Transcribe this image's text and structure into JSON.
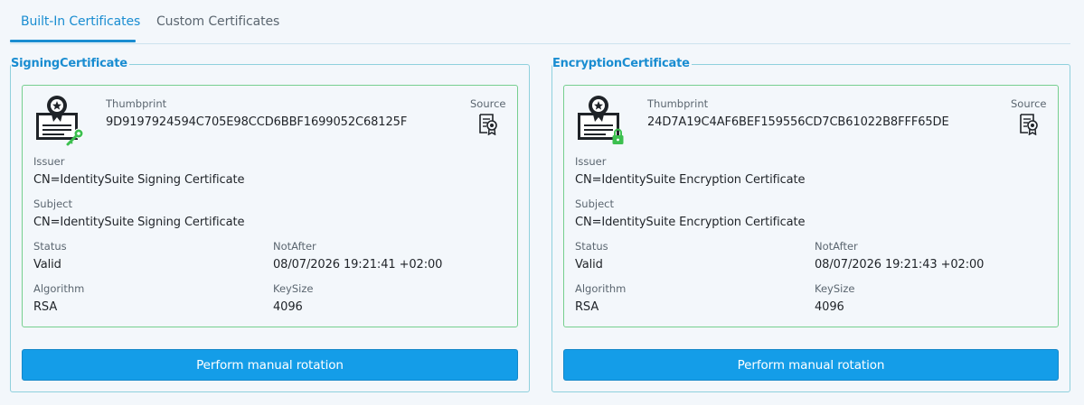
{
  "tabs": [
    {
      "label": "Built-In Certificates",
      "active": true
    },
    {
      "label": "Custom Certificates",
      "active": false
    }
  ],
  "accent_color": "#1a8dd1",
  "button_color": "#149de8",
  "card_border_color": "#76cf8f",
  "certificates": [
    {
      "title": "SigningCertificate",
      "type_icon": "certificate-key-icon",
      "thumbprint_label": "Thumbprint",
      "thumbprint": "9D9197924594C705E98CCD6BBF1699052C68125F",
      "source_label": "Source",
      "source_icon": "certificate-source-icon",
      "issuer_label": "Issuer",
      "issuer": "CN=IdentitySuite Signing Certificate",
      "subject_label": "Subject",
      "subject": "CN=IdentitySuite Signing Certificate",
      "status_label": "Status",
      "status": "Valid",
      "notafter_label": "NotAfter",
      "notafter": "08/07/2026 19:21:41 +02:00",
      "algorithm_label": "Algorithm",
      "algorithm": "RSA",
      "keysize_label": "KeySize",
      "keysize": "4096",
      "button_label": "Perform manual rotation"
    },
    {
      "title": "EncryptionCertificate",
      "type_icon": "certificate-lock-icon",
      "thumbprint_label": "Thumbprint",
      "thumbprint": "24D7A19C4AF6BEF159556CD7CB61022B8FFF65DE",
      "source_label": "Source",
      "source_icon": "certificate-source-icon",
      "issuer_label": "Issuer",
      "issuer": "CN=IdentitySuite Encryption Certificate",
      "subject_label": "Subject",
      "subject": "CN=IdentitySuite Encryption Certificate",
      "status_label": "Status",
      "status": "Valid",
      "notafter_label": "NotAfter",
      "notafter": "08/07/2026 19:21:43 +02:00",
      "algorithm_label": "Algorithm",
      "algorithm": "RSA",
      "keysize_label": "KeySize",
      "keysize": "4096",
      "button_label": "Perform manual rotation"
    }
  ]
}
